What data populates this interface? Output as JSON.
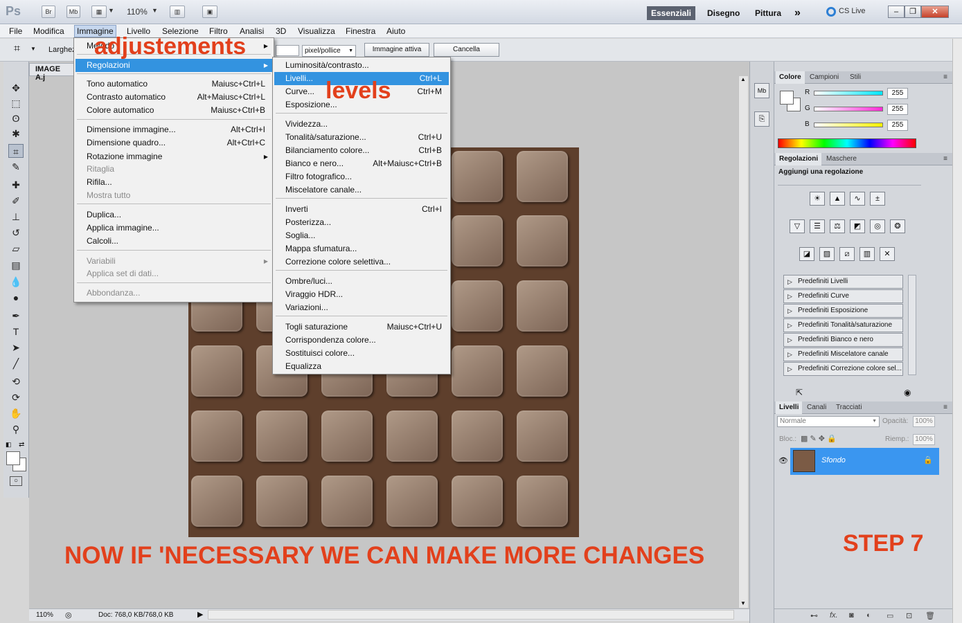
{
  "appbar": {
    "logo": "Ps",
    "br": "Br",
    "mb": "Mb",
    "zoom": "110%",
    "workspaces": [
      "Essenziali",
      "Disegno",
      "Pittura"
    ],
    "more": "»",
    "cslive": "CS Live"
  },
  "menubar": [
    "File",
    "Modifica",
    "Immagine",
    "Livello",
    "Selezione",
    "Filtro",
    "Analisi",
    "3D",
    "Visualizza",
    "Finestra",
    "Aiuto"
  ],
  "options": {
    "width_label": "Larghez",
    "unit": "pixel/pollice",
    "front_image": "Immagine attiva",
    "cancel": "Cancella"
  },
  "document": {
    "tab": "IMAGE A.j",
    "zoom": "110%",
    "docinfo": "Doc: 768,0 KB/768,0 KB"
  },
  "immagine_menu": {
    "items": [
      {
        "label": "Metodo",
        "sub": true
      },
      {
        "label": "Regolazioni",
        "sub": true,
        "highlight": true
      },
      {
        "label": "Tono automatico",
        "shortcut": "Maiusc+Ctrl+L"
      },
      {
        "label": "Contrasto automatico",
        "shortcut": "Alt+Maiusc+Ctrl+L"
      },
      {
        "label": "Colore automatico",
        "shortcut": "Maiusc+Ctrl+B"
      },
      {
        "label": "Dimensione immagine...",
        "shortcut": "Alt+Ctrl+I"
      },
      {
        "label": "Dimensione quadro...",
        "shortcut": "Alt+Ctrl+C"
      },
      {
        "label": "Rotazione immagine",
        "sub": true
      },
      {
        "label": "Ritaglia",
        "disabled": true
      },
      {
        "label": "Rifila..."
      },
      {
        "label": "Mostra tutto",
        "disabled": true
      },
      {
        "label": "Duplica..."
      },
      {
        "label": "Applica immagine..."
      },
      {
        "label": "Calcoli..."
      },
      {
        "label": "Variabili",
        "disabled": true,
        "sub": true
      },
      {
        "label": "Applica set di dati...",
        "disabled": true
      },
      {
        "label": "Abbondanza...",
        "disabled": true
      }
    ]
  },
  "regolazioni_menu": {
    "items": [
      {
        "label": "Luminosità/contrasto..."
      },
      {
        "label": "Livelli...",
        "shortcut": "Ctrl+L",
        "highlight": true
      },
      {
        "label": "Curve...",
        "shortcut": "Ctrl+M"
      },
      {
        "label": "Esposizione..."
      },
      {
        "label": "Vividezza..."
      },
      {
        "label": "Tonalità/saturazione...",
        "shortcut": "Ctrl+U"
      },
      {
        "label": "Bilanciamento colore...",
        "shortcut": "Ctrl+B"
      },
      {
        "label": "Bianco e nero...",
        "shortcut": "Alt+Maiusc+Ctrl+B"
      },
      {
        "label": "Filtro fotografico..."
      },
      {
        "label": "Miscelatore canale..."
      },
      {
        "label": "Inverti",
        "shortcut": "Ctrl+I"
      },
      {
        "label": "Posterizza..."
      },
      {
        "label": "Soglia..."
      },
      {
        "label": "Mappa sfumatura..."
      },
      {
        "label": "Correzione colore selettiva..."
      },
      {
        "label": "Ombre/luci..."
      },
      {
        "label": "Viraggio HDR..."
      },
      {
        "label": "Variazioni..."
      },
      {
        "label": "Togli saturazione",
        "shortcut": "Maiusc+Ctrl+U"
      },
      {
        "label": "Corrispondenza colore..."
      },
      {
        "label": "Sostituisci colore..."
      },
      {
        "label": "Equalizza"
      }
    ]
  },
  "color_panel": {
    "tabs": [
      "Colore",
      "Campioni",
      "Stili"
    ],
    "channels": [
      {
        "name": "R",
        "value": "255",
        "color": "#00e5ff"
      },
      {
        "name": "G",
        "value": "255",
        "color": "#ff2bd6"
      },
      {
        "name": "B",
        "value": "255",
        "color": "#f4f000"
      }
    ]
  },
  "adjust_panel": {
    "tabs": [
      "Regolazioni",
      "Maschere"
    ],
    "title": "Aggiungi una regolazione",
    "presets": [
      "Predefiniti Livelli",
      "Predefiniti Curve",
      "Predefiniti Esposizione",
      "Predefiniti Tonalità/saturazione",
      "Predefiniti Bianco e nero",
      "Predefiniti Miscelatore canale",
      "Predefiniti Correzione colore sel..."
    ]
  },
  "layers_panel": {
    "tabs": [
      "Livelli",
      "Canali",
      "Tracciati"
    ],
    "blend_mode": "Normale",
    "opacity_label": "Opacità:",
    "opacity": "100%",
    "lock_label": "Bloc.:",
    "fill_label": "Riemp.:",
    "fill": "100%",
    "layer_name": "Sfondo"
  },
  "annotations": {
    "adjustments": "adjustements",
    "levels": "levels",
    "note": "NOW IF 'NECESSARY WE CAN MAKE MORE CHANGES",
    "step": "STEP 7",
    "color": "#e2401c"
  }
}
